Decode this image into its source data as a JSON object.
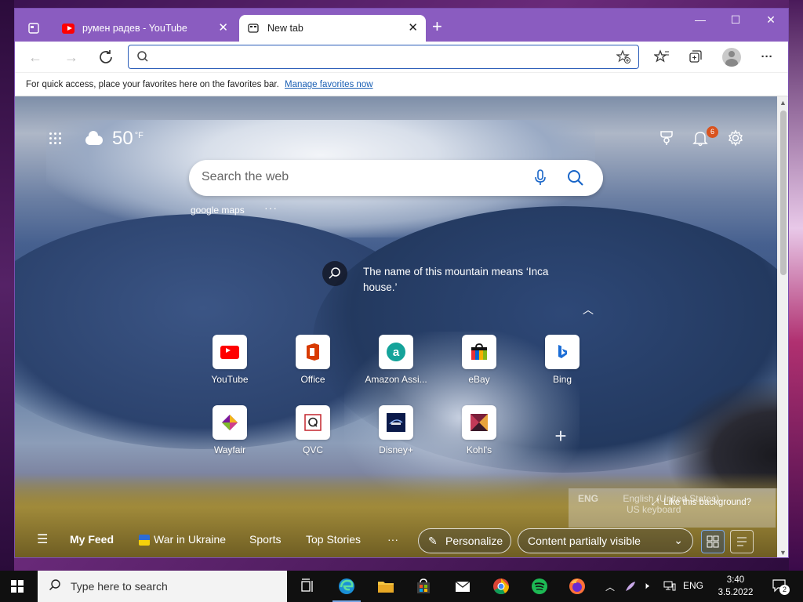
{
  "tabs": [
    {
      "label": "румен радев - YouTube",
      "icon": "youtube-icon"
    },
    {
      "label": "New tab",
      "icon": "new-tab-icon"
    }
  ],
  "address": {
    "value": "",
    "placeholder": ""
  },
  "favbar": {
    "text": "For quick access, place your favorites here on the favorites bar.",
    "link": "Manage favorites now"
  },
  "weather": {
    "temp": "50",
    "unit": "°F"
  },
  "notifications": {
    "count": "6"
  },
  "search": {
    "placeholder": "Search the web",
    "suggestion": "google maps",
    "more": "···"
  },
  "fact": "The name of this mountain means ‘Inca house.’",
  "tiles": [
    {
      "label": "YouTube"
    },
    {
      "label": "Office"
    },
    {
      "label": "Amazon Assi..."
    },
    {
      "label": "eBay"
    },
    {
      "label": "Bing"
    },
    {
      "label": "Wayfair"
    },
    {
      "label": "QVC"
    },
    {
      "label": "Disney+"
    },
    {
      "label": "Kohl's"
    }
  ],
  "ime": {
    "lang": "ENG",
    "name": "English (United States)",
    "layout": "US keyboard"
  },
  "background": {
    "like": "Like this background?"
  },
  "feed": {
    "my_feed": "My Feed",
    "war": "War in Ukraine",
    "sports": "Sports",
    "top_stories": "Top Stories",
    "more": "···",
    "personalize": "Personalize",
    "content": "Content partially visible"
  },
  "taskbar": {
    "search_placeholder": "Type here to search",
    "lang": "ENG",
    "time": "3:40",
    "date": "3.5.2022 г.",
    "notif_count": "2"
  },
  "colors": {
    "tab_strip": "#8a5cc0",
    "accent": "#1a66c8",
    "badge": "#d9531e"
  }
}
